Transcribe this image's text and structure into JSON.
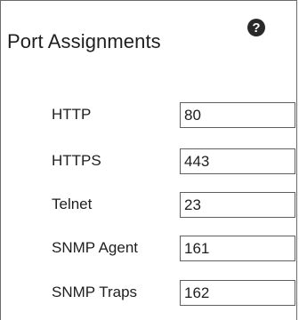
{
  "section": {
    "title": "Port Assignments",
    "help_icon": "help-icon"
  },
  "ports": [
    {
      "label": "HTTP",
      "value": "80"
    },
    {
      "label": "HTTPS",
      "value": "443"
    },
    {
      "label": "Telnet",
      "value": "23"
    },
    {
      "label": "SNMP Agent",
      "value": "161"
    },
    {
      "label": "SNMP Traps",
      "value": "162"
    }
  ]
}
